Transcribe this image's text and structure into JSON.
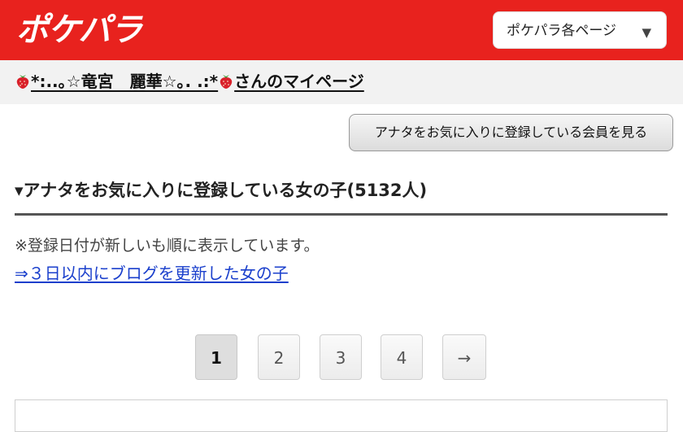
{
  "header": {
    "logo_text": "ポケパラ",
    "pages_button_label": "ポケパラ各ページ",
    "pages_button_caret": "▼",
    "brand_color": "#e8221e"
  },
  "userbar": {
    "link_text": "*:..｡☆竜宮　麗華☆｡. .:*",
    "suffix": "さんのマイページ",
    "icon": "strawberry-icon"
  },
  "fav_button_label": "アナタをお気に入りに登録している会員を見る",
  "section": {
    "title": "▾アナタをお気に入りに登録している女の子(5132人)"
  },
  "note_text": "※登録日付が新しいも順に表示しています。",
  "blog_link_text": "⇒３日以内にブログを更新した女の子",
  "pager": {
    "pages": [
      "1",
      "2",
      "3",
      "4"
    ],
    "current": "1",
    "next_label": "→"
  }
}
